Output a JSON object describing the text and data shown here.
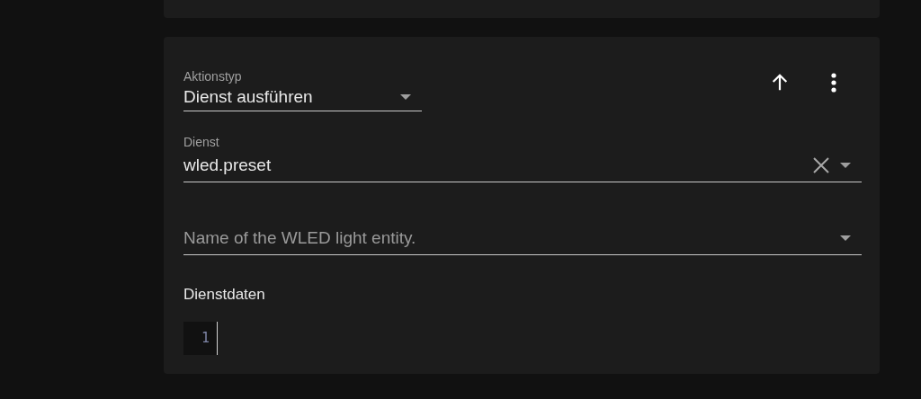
{
  "action_type": {
    "label": "Aktionstyp",
    "value": "Dienst ausführen"
  },
  "service": {
    "label": "Dienst",
    "value": "wled.preset"
  },
  "entity": {
    "placeholder": "Name of the WLED light entity."
  },
  "service_data": {
    "label": "Dienstdaten",
    "line_numbers": [
      "1"
    ]
  }
}
